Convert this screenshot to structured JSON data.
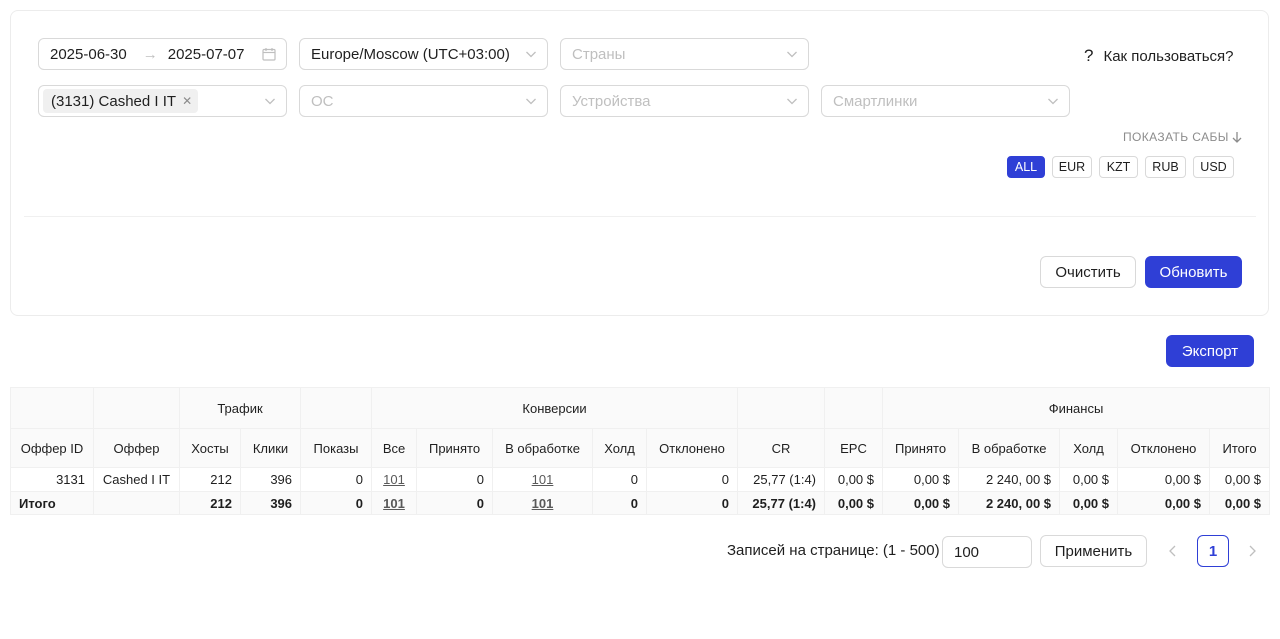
{
  "filters": {
    "date_from": "2025-06-30",
    "date_to": "2025-07-07",
    "timezone": "Europe/Moscow (UTC+03:00)",
    "countries_placeholder": "Страны",
    "offer_tag": "(3131) Cashed I IT",
    "os_placeholder": "ОС",
    "devices_placeholder": "Устройства",
    "smartlinks_placeholder": "Смартлинки",
    "help_icon": "?",
    "help_label": "Как пользоваться?",
    "show_subs_label": "ПОКАЗАТЬ САБЫ",
    "currencies": [
      "ALL",
      "EUR",
      "KZT",
      "RUB",
      "USD"
    ],
    "active_currency": "ALL",
    "clear_label": "Очистить",
    "refresh_label": "Обновить"
  },
  "export_label": "Экспорт",
  "table": {
    "groups": {
      "traffic": "Трафик",
      "conversions": "Конверсии",
      "finance": "Финансы"
    },
    "columns": [
      "Оффер ID",
      "Оффер",
      "Хосты",
      "Клики",
      "Показы",
      "Все",
      "Принято",
      "В обработке",
      "Холд",
      "Отклонено",
      "CR",
      "EPC",
      "Принято",
      "В обработке",
      "Холд",
      "Отклонено",
      "Итого"
    ],
    "rows": [
      [
        "3131",
        "Cashed I IT",
        "212",
        "396",
        "0",
        "101",
        "0",
        "101",
        "0",
        "0",
        "25,77 (1:4)",
        "0,00 $",
        "0,00 $",
        "2 240, 00 $",
        "0,00 $",
        "0,00 $",
        "0,00 $"
      ]
    ],
    "total": [
      "Итого",
      "",
      "212",
      "396",
      "0",
      "101",
      "0",
      "101",
      "0",
      "0",
      "25,77 (1:4)",
      "0,00 $",
      "0,00 $",
      "2 240, 00 $",
      "0,00 $",
      "0,00 $",
      "0,00 $"
    ]
  },
  "pagination": {
    "label": "Записей на странице: (1 - 500)",
    "page_size": "100",
    "apply_label": "Применить",
    "current_page": "1"
  },
  "colors": {
    "primary": "#2f3fd6",
    "border": "#d9d9d9",
    "placeholder": "#bfbfbf"
  }
}
